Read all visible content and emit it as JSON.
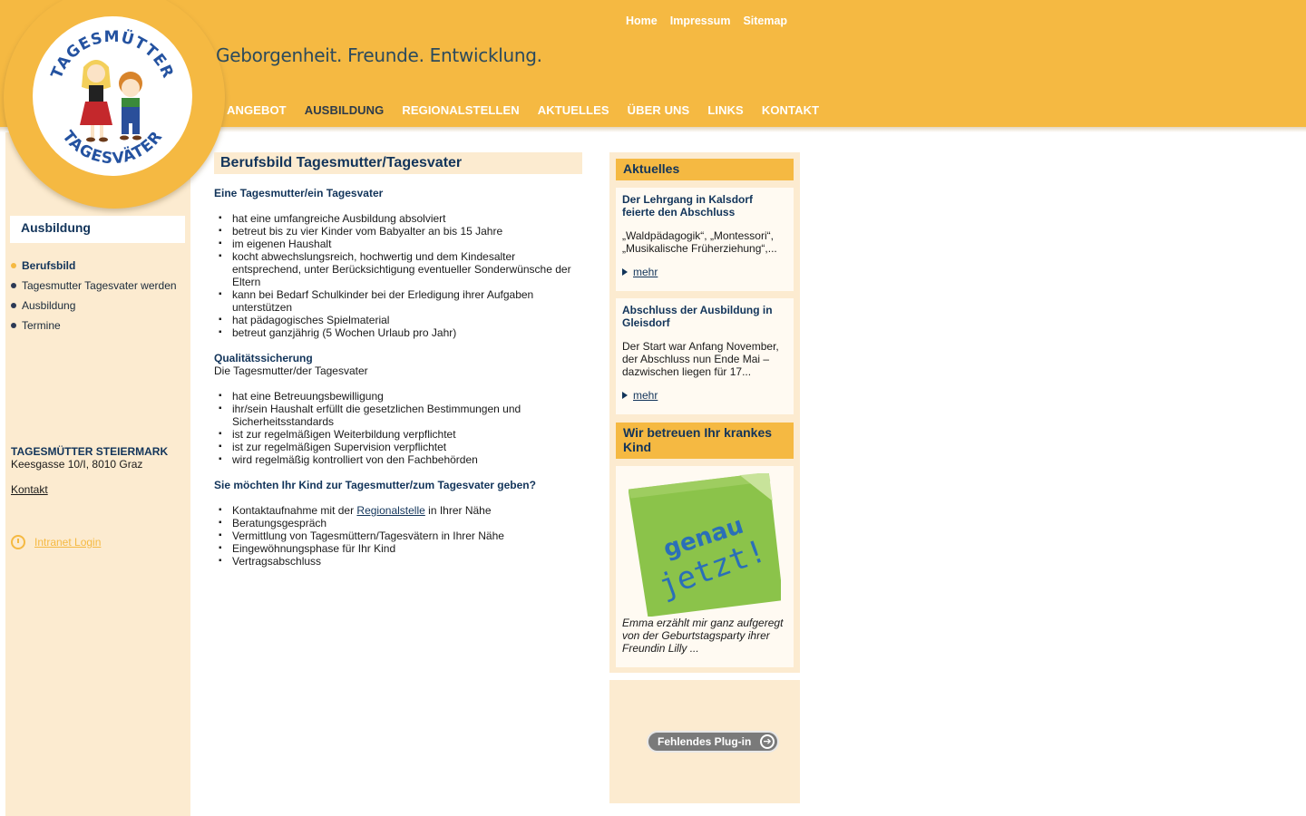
{
  "logo": {
    "arc_top": "TAGESMÜTTER",
    "arc_bottom": "TAGESVÄTER"
  },
  "tagline": "Geborgenheit. Freunde. Entwicklung.",
  "topnav": [
    "Home",
    "Impressum",
    "Sitemap"
  ],
  "mainnav": [
    {
      "label": "ANGEBOT",
      "active": false
    },
    {
      "label": "AUSBILDUNG",
      "active": true
    },
    {
      "label": "REGIONALSTELLEN",
      "active": false
    },
    {
      "label": "AKTUELLES",
      "active": false
    },
    {
      "label": "ÜBER UNS",
      "active": false
    },
    {
      "label": "LINKS",
      "active": false
    },
    {
      "label": "KONTAKT",
      "active": false
    }
  ],
  "sidebar": {
    "title": "Ausbildung",
    "items": [
      {
        "label": "Berufsbild",
        "active": true
      },
      {
        "label": "Tagesmutter Tagesvater werden",
        "active": false
      },
      {
        "label": "Ausbildung",
        "active": false
      },
      {
        "label": "Termine",
        "active": false
      }
    ],
    "org_name": "TAGESMÜTTER STEIERMARK",
    "org_address": "Keesgasse 10/I, 8010 Graz",
    "contact_link": "Kontakt",
    "intranet_link": "Intranet Login"
  },
  "content": {
    "title": "Berufsbild Tagesmutter/Tagesvater",
    "section1_heading": "Eine Tagesmutter/ein Tagesvater",
    "section1_items": [
      "hat eine umfangreiche Ausbildung absolviert",
      "betreut bis zu vier Kinder vom Babyalter an bis 15 Jahre",
      "im eigenen Haushalt",
      "kocht abwechslungsreich, hochwertig und dem Kindesalter entsprechend, unter Berücksichtigung eventueller Sonderwünsche der Eltern",
      "kann bei Bedarf Schulkinder bei der Erledigung ihrer Aufgaben unterstützen",
      "hat pädagogisches Spielmaterial",
      "betreut ganzjährig (5 Wochen Urlaub pro Jahr)"
    ],
    "section2_heading": "Qualitätssicherung",
    "section2_intro": "Die Tagesmutter/der Tagesvater",
    "section2_items": [
      "hat eine Betreuungsbewilligung",
      "ihr/sein Haushalt erfüllt die gesetzlichen Bestimmungen und Sicherheitsstandards",
      "ist zur regelmäßigen Weiterbildung verpflichtet",
      "ist zur regelmäßigen Supervision verpflichtet",
      "wird regelmäßig kontrolliert von den Fachbehörden"
    ],
    "section3_heading": "Sie möchten Ihr Kind zur Tagesmutter/zum Tagesvater geben?",
    "section3_item1_before": "Kontaktaufnahme mit der ",
    "section3_item1_link": "Regionalstelle",
    "section3_item1_after": " in Ihrer Nähe",
    "section3_items": [
      "Beratungsgespräch",
      "Vermittlung von Tagesmüttern/Tagesvätern in Ihrer Nähe",
      "Eingewöhnungsphase für Ihr Kind",
      "Vertragsabschluss"
    ]
  },
  "aktuelles": {
    "heading": "Aktuelles",
    "news": [
      {
        "title": "Der Lehrgang in Kalsdorf feierte den Abschluss",
        "text": "„Waldpädagogik“, „Montessori“, „Musikalische Früherziehung“,...",
        "more": "mehr"
      },
      {
        "title": "Abschluss der Ausbildung in Gleisdorf",
        "text": "Der Start war Anfang November, der Abschluss nun Ende Mai – dazwischen liegen für 17...",
        "more": "mehr"
      }
    ]
  },
  "sick_child": {
    "heading": "Wir betreuen Ihr krankes Kind",
    "note_line1": "genau",
    "note_line2": "jetzt!",
    "caption": "Emma erzählt mir ganz aufgeregt von der Geburtstagsparty ihrer Freundin Lilly ..."
  },
  "plugin": {
    "label": "Fehlendes Plug-in"
  },
  "colors": {
    "accent": "#f5b942",
    "panel": "#fcebd0",
    "navy": "#12345a"
  }
}
